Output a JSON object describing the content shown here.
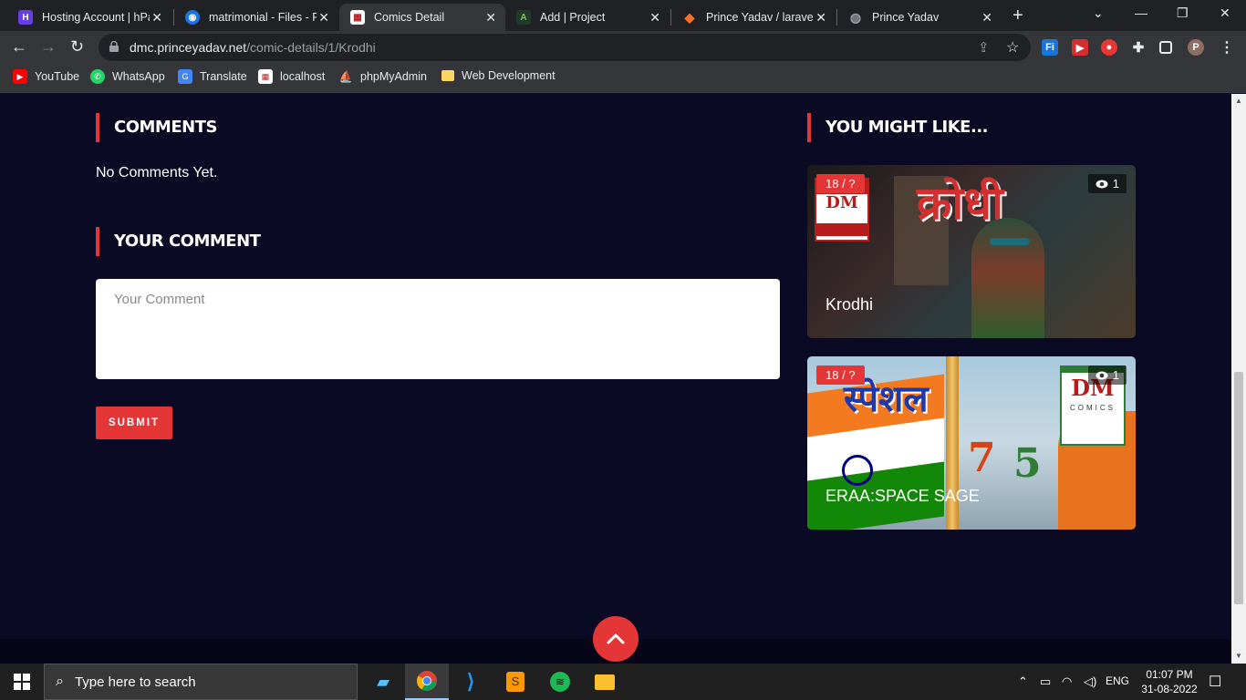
{
  "browser": {
    "tabs": [
      {
        "title": "Hosting Account | hPa",
        "icon": "hostinger-icon",
        "color": "#673de6"
      },
      {
        "title": "matrimonial - Files - Fi",
        "icon": "files-icon",
        "color": "#1a73e8"
      },
      {
        "title": "Comics Detail",
        "icon": "comics-icon",
        "color": "#b71c1c"
      },
      {
        "title": "Add | Project",
        "icon": "adonis-icon",
        "color": "#2e7d32"
      },
      {
        "title": "Prince Yadav / laravel-",
        "icon": "gitlab-icon",
        "color": "#fc6d26"
      },
      {
        "title": "Prince Yadav",
        "icon": "globe-icon",
        "color": "#9aa0a6"
      }
    ],
    "active_tab": 2,
    "url_host": "dmc.princeyadav.net",
    "url_path": "/comic-details/1/Krodhi",
    "bookmarks": [
      {
        "label": "YouTube",
        "icon": "youtube-icon"
      },
      {
        "label": "WhatsApp",
        "icon": "whatsapp-icon"
      },
      {
        "label": "Translate",
        "icon": "translate-icon"
      },
      {
        "label": "localhost",
        "icon": "localhost-icon"
      },
      {
        "label": "phpMyAdmin",
        "icon": "phpmyadmin-icon"
      },
      {
        "label": "Web Development",
        "icon": "folder-icon"
      }
    ]
  },
  "page": {
    "comments_title": "COMMENTS",
    "no_comments": "No Comments Yet.",
    "your_comment_title": "YOUR COMMENT",
    "comment_placeholder": "Your Comment",
    "submit_label": "SUBMIT",
    "related_title": "YOU MIGHT LIKE...",
    "related": [
      {
        "badge": "18 / ?",
        "views": "1",
        "title": "Krodhi",
        "cover_text": "क्रोधी"
      },
      {
        "badge": "18 / ?",
        "views": "1",
        "title": "ERAA:SPACE SAGE",
        "cover_text": "स्पेशल"
      }
    ]
  },
  "taskbar": {
    "search_placeholder": "Type here to search",
    "language": "ENG",
    "time": "01:07 PM",
    "date": "31-08-2022"
  },
  "colors": {
    "accent": "#e53637",
    "page_bg": "#0b0a24"
  }
}
